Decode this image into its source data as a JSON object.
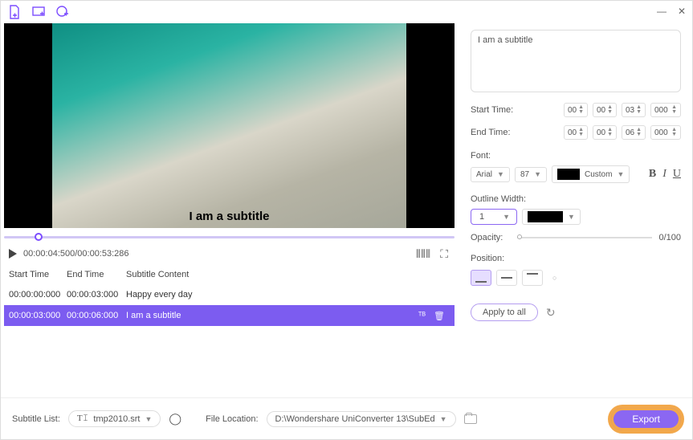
{
  "toolbar": {
    "icons": [
      "add-file",
      "add-folder",
      "add-url"
    ]
  },
  "window": {
    "minimize": "—",
    "close": "✕"
  },
  "video": {
    "overlay_subtitle": "I am a subtitle"
  },
  "playback": {
    "time_display": "00:00:04:500/00:00:53:286"
  },
  "table": {
    "headers": {
      "start": "Start Time",
      "end": "End Time",
      "content": "Subtitle Content"
    },
    "rows": [
      {
        "start": "00:00:00:000",
        "end": "00:00:03:000",
        "content": "Happy every day"
      },
      {
        "start": "00:00:03:000",
        "end": "00:00:06:000",
        "content": "I am a subtitle"
      }
    ]
  },
  "bottom": {
    "subtitle_list_label": "Subtitle List:",
    "subtitle_file": "tmp2010.srt",
    "file_location_label": "File Location:",
    "file_location": "D:\\Wondershare UniConverter 13\\SubEd",
    "export_label": "Export"
  },
  "editor": {
    "text_value": "I am a subtitle",
    "start_label": "Start Time:",
    "end_label": "End Time:",
    "start": [
      "00",
      "00",
      "03",
      "000"
    ],
    "end": [
      "00",
      "00",
      "06",
      "000"
    ],
    "font_label": "Font:",
    "font_name": "Arial",
    "font_size": "87",
    "color_mode": "Custom",
    "outline_label": "Outline Width:",
    "outline_value": "1",
    "opacity_label": "Opacity:",
    "opacity_value": "0/100",
    "position_label": "Position:",
    "apply_label": "Apply to all"
  }
}
